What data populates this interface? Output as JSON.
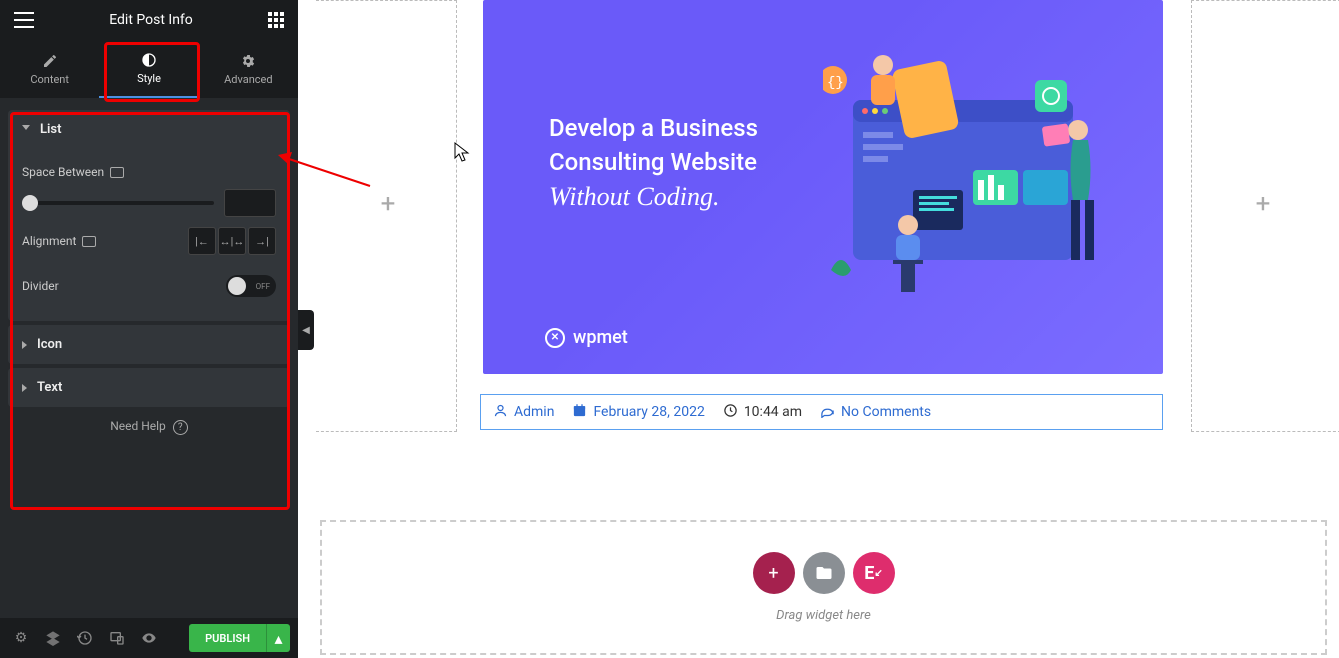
{
  "header": {
    "title": "Edit Post Info"
  },
  "tabs": {
    "content": "Content",
    "style": "Style",
    "advanced": "Advanced",
    "active": "style"
  },
  "style_panel": {
    "sections": {
      "list": {
        "title": "List",
        "space_between": {
          "label": "Space Between",
          "value": ""
        },
        "alignment": {
          "label": "Alignment",
          "options": [
            "left",
            "center",
            "right"
          ]
        },
        "divider": {
          "label": "Divider",
          "value": "OFF"
        }
      },
      "icon": {
        "title": "Icon"
      },
      "text": {
        "title": "Text"
      }
    }
  },
  "help": {
    "label": "Need Help"
  },
  "footer": {
    "publish": "PUBLISH"
  },
  "hero": {
    "line1": "Develop a Business",
    "line2": "Consulting Website",
    "line3": "Without Coding.",
    "brand": "wpmet"
  },
  "post_info": {
    "author": "Admin",
    "date": "February 28, 2022",
    "time": "10:44 am",
    "comments": "No Comments"
  },
  "drop_area": {
    "drag_text": "Drag widget here"
  }
}
